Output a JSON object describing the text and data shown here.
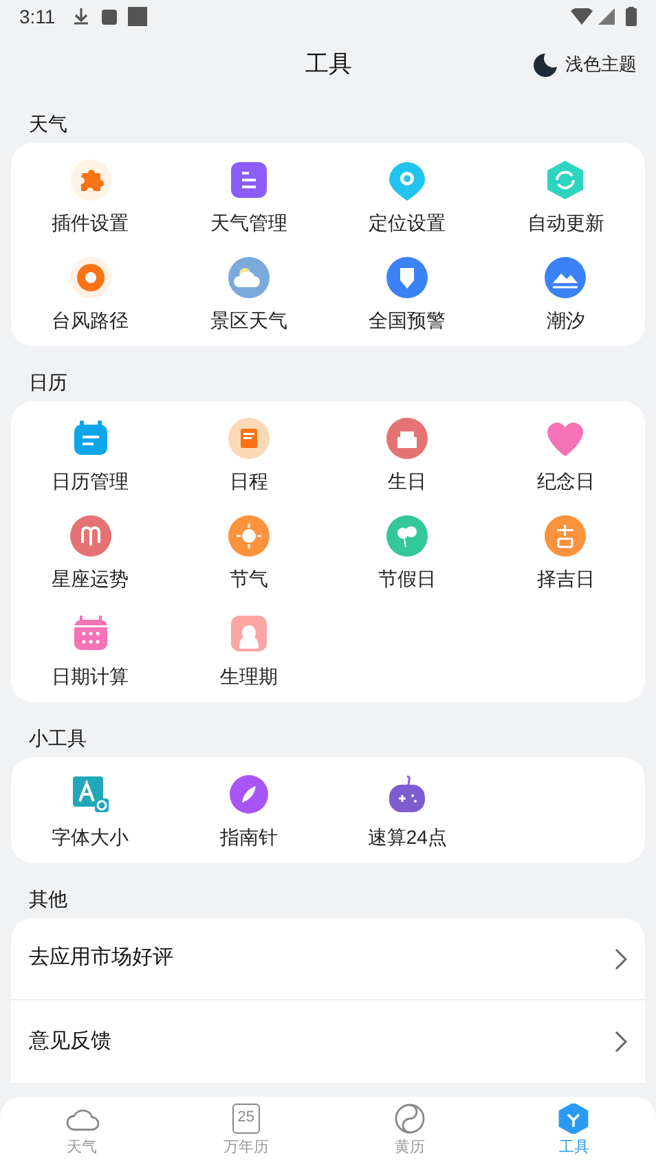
{
  "status_bar": {
    "time": "3:11"
  },
  "header": {
    "title": "工具",
    "theme_toggle": "浅色主题"
  },
  "sections": [
    {
      "title": "天气",
      "items": [
        {
          "label": "插件设置"
        },
        {
          "label": "天气管理"
        },
        {
          "label": "定位设置"
        },
        {
          "label": "自动更新"
        },
        {
          "label": "台风路径"
        },
        {
          "label": "景区天气"
        },
        {
          "label": "全国预警"
        },
        {
          "label": "潮汐"
        }
      ]
    },
    {
      "title": "日历",
      "items": [
        {
          "label": "日历管理"
        },
        {
          "label": "日程"
        },
        {
          "label": "生日"
        },
        {
          "label": "纪念日"
        },
        {
          "label": "星座运势"
        },
        {
          "label": "节气"
        },
        {
          "label": "节假日"
        },
        {
          "label": "择吉日"
        },
        {
          "label": "日期计算"
        },
        {
          "label": "生理期"
        }
      ]
    },
    {
      "title": "小工具",
      "items": [
        {
          "label": "字体大小"
        },
        {
          "label": "指南针"
        },
        {
          "label": "速算24点"
        }
      ]
    }
  ],
  "other": {
    "title": "其他",
    "items": [
      "去应用市场好评",
      "意见反馈"
    ]
  },
  "tab_bar": [
    {
      "label": "天气",
      "selected": false
    },
    {
      "label": "万年历",
      "selected": false,
      "badge": "25"
    },
    {
      "label": "黄历",
      "selected": false
    },
    {
      "label": "工具",
      "selected": true
    }
  ]
}
